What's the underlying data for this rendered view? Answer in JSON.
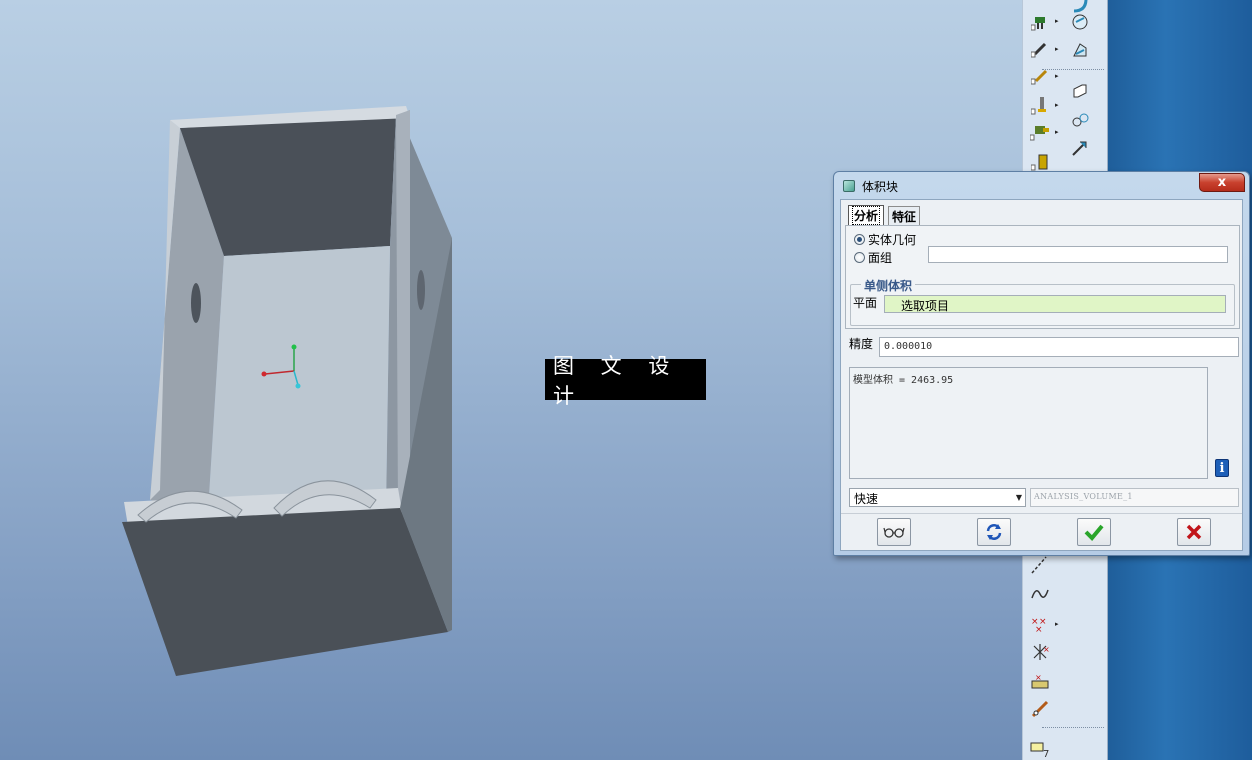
{
  "watermark": "图 文 设 计",
  "dialog": {
    "title": "体积块",
    "close_symbol": "x",
    "tabs": [
      {
        "label": "分析",
        "active": true
      },
      {
        "label": "特征",
        "active": false
      }
    ],
    "radio_options": [
      {
        "label": "实体几何",
        "checked": true
      },
      {
        "label": "面组",
        "checked": false
      }
    ],
    "one_side_group": "单侧体积",
    "plane_label": "平面",
    "plane_value": "选取项目",
    "precision_label": "精度",
    "precision_value": "0.000010",
    "result_text": "模型体积 = 2463.95",
    "info_symbol": "i",
    "mode_select": "快速",
    "analysis_name": "ANALYSIS_VOLUME_1"
  },
  "colors": {
    "viewport_top": "#b9cfe4",
    "viewport_bottom": "#6f8db6",
    "plane_field_bg": "#e0f5c6",
    "ok_green": "#2aa52a",
    "cancel_red": "#c1151a"
  },
  "toolbar_icons": [
    "datum-plane-icon",
    "datum-axis-icon",
    "datum-point-icon",
    "sketch-icon",
    "extrude-icon",
    "revolve-icon",
    "round-icon",
    "chamfer-icon",
    "shell-icon",
    "rib-icon",
    "draft-icon",
    "curve-icon",
    "point-icon",
    "coordinate-system-icon",
    "analysis-icon",
    "measure-icon",
    "annotation-icon"
  ]
}
